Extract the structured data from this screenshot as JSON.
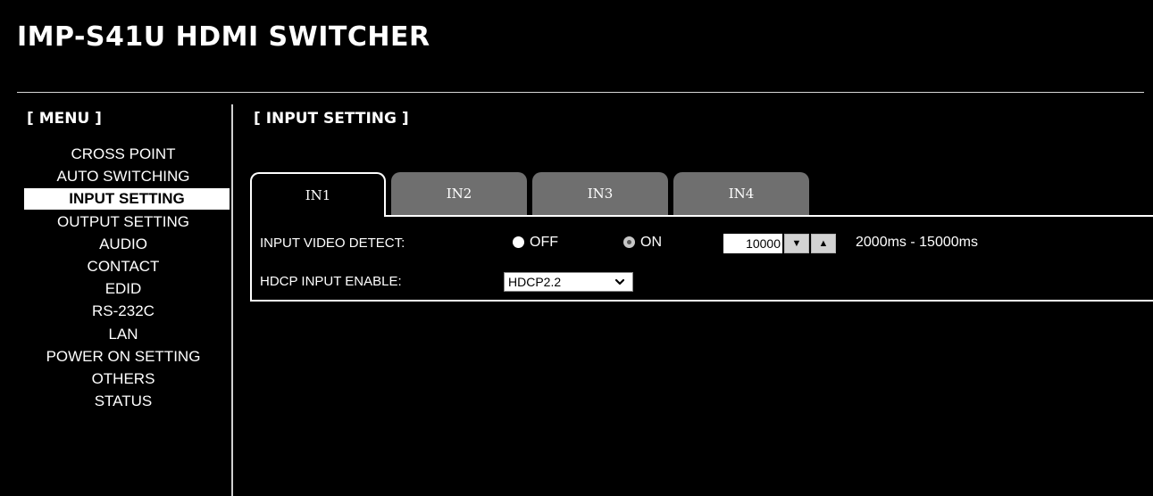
{
  "header": {
    "title": "IMP-S41U HDMI SWITCHER"
  },
  "sidebar": {
    "heading": "[ MENU ]",
    "items": [
      {
        "label": "CROSS POINT"
      },
      {
        "label": "AUTO SWITCHING"
      },
      {
        "label": "INPUT SETTING",
        "active": true
      },
      {
        "label": "OUTPUT SETTING"
      },
      {
        "label": "AUDIO"
      },
      {
        "label": "CONTACT"
      },
      {
        "label": "EDID"
      },
      {
        "label": "RS-232C"
      },
      {
        "label": "LAN"
      },
      {
        "label": "POWER ON SETTING"
      },
      {
        "label": "OTHERS"
      },
      {
        "label": "STATUS"
      }
    ]
  },
  "main": {
    "section_title": "[ INPUT SETTING ]",
    "tabs": [
      {
        "label": "IN1",
        "active": true
      },
      {
        "label": "IN2"
      },
      {
        "label": "IN3"
      },
      {
        "label": "IN4"
      }
    ],
    "input_video_detect": {
      "label": "INPUT VIDEO DETECT:",
      "options": [
        {
          "label": "OFF",
          "checked": false
        },
        {
          "label": "ON",
          "checked": true
        }
      ],
      "value": "10000",
      "decrement_symbol": "▼",
      "increment_symbol": "▲",
      "range_text": "2000ms - 15000ms"
    },
    "hdcp_input_enable": {
      "label": "HDCP INPUT ENABLE:",
      "selected": "HDCP2.2"
    }
  },
  "colors": {
    "background": "#000000",
    "text": "#ffffff",
    "tab_inactive": "#6f6f6f",
    "active_menu_bg": "#ffffff",
    "radio_checked": "#c7c7c7"
  }
}
